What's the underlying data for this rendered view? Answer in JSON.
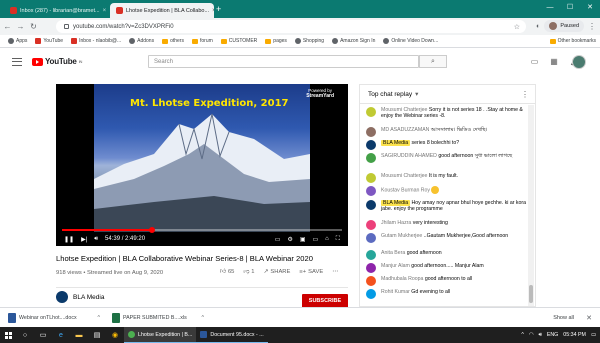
{
  "browser": {
    "tabs": [
      {
        "label": "Inbox (287) - librarian@bramet...",
        "active": false
      },
      {
        "label": "Lhotse Expedition | BLA Collabo...",
        "active": true
      }
    ],
    "url": "youtube.com/watch?v=Zc3DVXPRFi0",
    "paused_label": "Paused",
    "bookmarks": [
      "Apps",
      "YouTube",
      "Inbox - nlaobib@...",
      "Addons",
      "others",
      "forum",
      "CUSTOMER",
      "pages",
      "Shopping",
      "Amazon Sign In",
      "Online Video Down..."
    ],
    "other_bookmarks": "Other bookmarks"
  },
  "youtube": {
    "search_placeholder": "Search",
    "logo_text": "YouTube",
    "logo_sup": "IN"
  },
  "video": {
    "overlay_title": "Mt. Lhotse Expedition, 2017",
    "powered_by": "Powered by",
    "powered_brand": "StreamYard",
    "time": "54:39 / 2:49:20",
    "progress": 0.322,
    "title": "Lhotse Expedition | BLA Collaborative Webinar Series-8 | BLA Webinar 2020",
    "meta": "918 views • Streamed live on Aug 9, 2020",
    "likes": "65",
    "dislikes": "1",
    "share": "SHARE",
    "save": "SAVE",
    "channel": "BLA Media",
    "subscribe": "SUBSCRIBE"
  },
  "chat": {
    "header": "Top chat replay",
    "messages": [
      {
        "author": "Mousumi Chatterjee",
        "text": "Sorry it is not series 18 . .Stay at home & enjoy the Webinar series -8.",
        "mod": false,
        "color": "#c0ca33"
      },
      {
        "author": "MD ASADUZZAMAN",
        "text": "আসসালাম। ভিডিও দেখছি।",
        "mod": false,
        "color": "#8d6e63"
      },
      {
        "author": "BLA Media",
        "text": "series 8 bolechhi to?",
        "mod": true,
        "color": "#0b3a6b"
      },
      {
        "author": "SAGIRUDDIN AHAMED",
        "text": "good afternoon সুধা ভালো লাগছে",
        "mod": false,
        "color": "#43a047"
      },
      {
        "author": "Mousumi Chatterjee",
        "text": "It is my fault.",
        "mod": false,
        "color": "#c0ca33"
      },
      {
        "author": "Koustav Burman Roy",
        "text": "",
        "mod": false,
        "color": "#7e57c2",
        "emoji": true
      },
      {
        "author": "BLA Media",
        "text": "Hoy amay noy apnar bhul hoye gechhe. ki ar kora jabe. enjoy the programme",
        "mod": true,
        "color": "#0b3a6b"
      },
      {
        "author": "Jhilam Hazra",
        "text": "very interesting",
        "mod": false,
        "color": "#ec407a"
      },
      {
        "author": "Gutam Mukherjee",
        "text": "..Gautam Mukherjee,Good afternoon",
        "mod": false,
        "color": "#5c6bc0"
      },
      {
        "author": "Anita Bera",
        "text": "good afternoon",
        "mod": false,
        "color": "#26a69a"
      },
      {
        "author": "Manjur Alam",
        "text": "good afternoon..... Manjur Alam",
        "mod": false,
        "color": "#8e24aa"
      },
      {
        "author": "Madhubala Roopa",
        "text": "good afternoon to all",
        "mod": false,
        "color": "#f4511e"
      },
      {
        "author": "Rohit Kumar",
        "text": "Gd evening to all",
        "mod": false,
        "color": "#039be5"
      }
    ]
  },
  "downloads": [
    {
      "name": "Webinar onTLhot....docx",
      "type": "doc"
    },
    {
      "name": "PAPER SUBMITED B....xls",
      "type": "xls"
    }
  ],
  "downloads_show_all": "Show all",
  "taskbar": {
    "apps": [
      {
        "label": "Lhotse Expedition | B...",
        "active": true,
        "color": "#4caf50"
      },
      {
        "label": "Document 95.docx - ...",
        "active": false,
        "color": "#2b579a"
      }
    ],
    "lang": "ENG",
    "time": "05:34 PM"
  }
}
